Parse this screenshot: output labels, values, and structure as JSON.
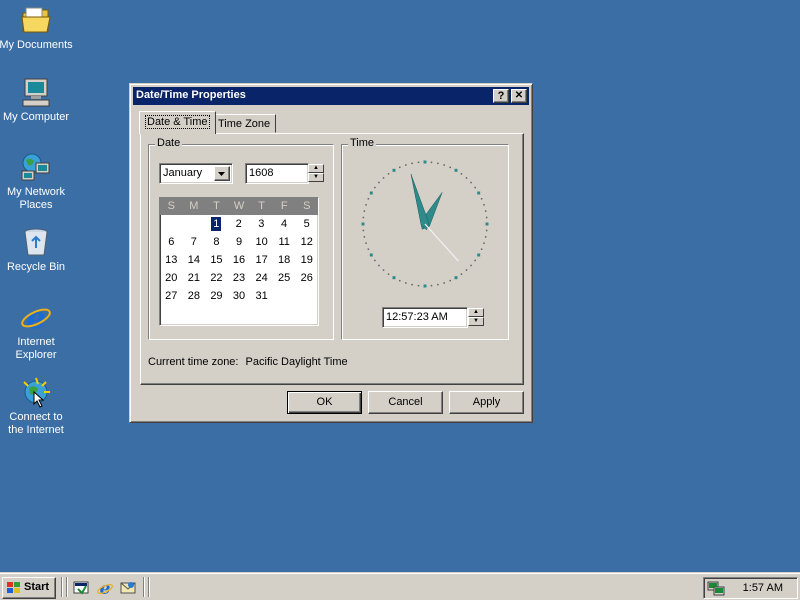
{
  "desktop": {
    "icons": [
      {
        "label_lines": [
          "My Documents"
        ]
      },
      {
        "label_lines": [
          "My Computer"
        ]
      },
      {
        "label_lines": [
          "My Network",
          "Places"
        ]
      },
      {
        "label_lines": [
          "Recycle Bin"
        ]
      },
      {
        "label_lines": [
          "Internet",
          "Explorer"
        ]
      },
      {
        "label_lines": [
          "Connect to",
          "the Internet"
        ]
      }
    ]
  },
  "dialog": {
    "title": "Date/Time Properties",
    "help_button": "?",
    "close_button": "✕",
    "tabs": [
      {
        "label": "Date & Time",
        "active": true
      },
      {
        "label": "Time Zone",
        "active": false
      }
    ],
    "date_group_label": "Date",
    "month": "January",
    "year": "1608",
    "calendar": {
      "weekday_headers": [
        "S",
        "M",
        "T",
        "W",
        "T",
        "F",
        "S"
      ],
      "weeks": [
        [
          "",
          "",
          "",
          "1",
          "2",
          "3",
          "4",
          "5"
        ],
        [
          "6",
          "7",
          "8",
          "9",
          "10",
          "11",
          "12"
        ],
        [
          "13",
          "14",
          "15",
          "16",
          "17",
          "18",
          "19"
        ],
        [
          "20",
          "21",
          "22",
          "23",
          "24",
          "25",
          "26"
        ],
        [
          "27",
          "28",
          "29",
          "30",
          "31",
          "",
          ""
        ]
      ],
      "selected_day": "1"
    },
    "time_group_label": "Time",
    "time_value": "12:57:23 AM",
    "clock": {
      "hour": 12,
      "minute": 57,
      "second": 23
    },
    "current_time_zone_label": "Current time zone:",
    "current_time_zone_value": "Pacific Daylight Time",
    "buttons": {
      "ok": "OK",
      "cancel": "Cancel",
      "apply": "Apply"
    }
  },
  "taskbar": {
    "start_label": "Start",
    "clock": "1:57 AM"
  },
  "colors": {
    "desktop": "#3a6ea5",
    "titlebar": "#0a246a",
    "face": "#d4d0c8",
    "clock_accent": "#2e8b8b"
  }
}
